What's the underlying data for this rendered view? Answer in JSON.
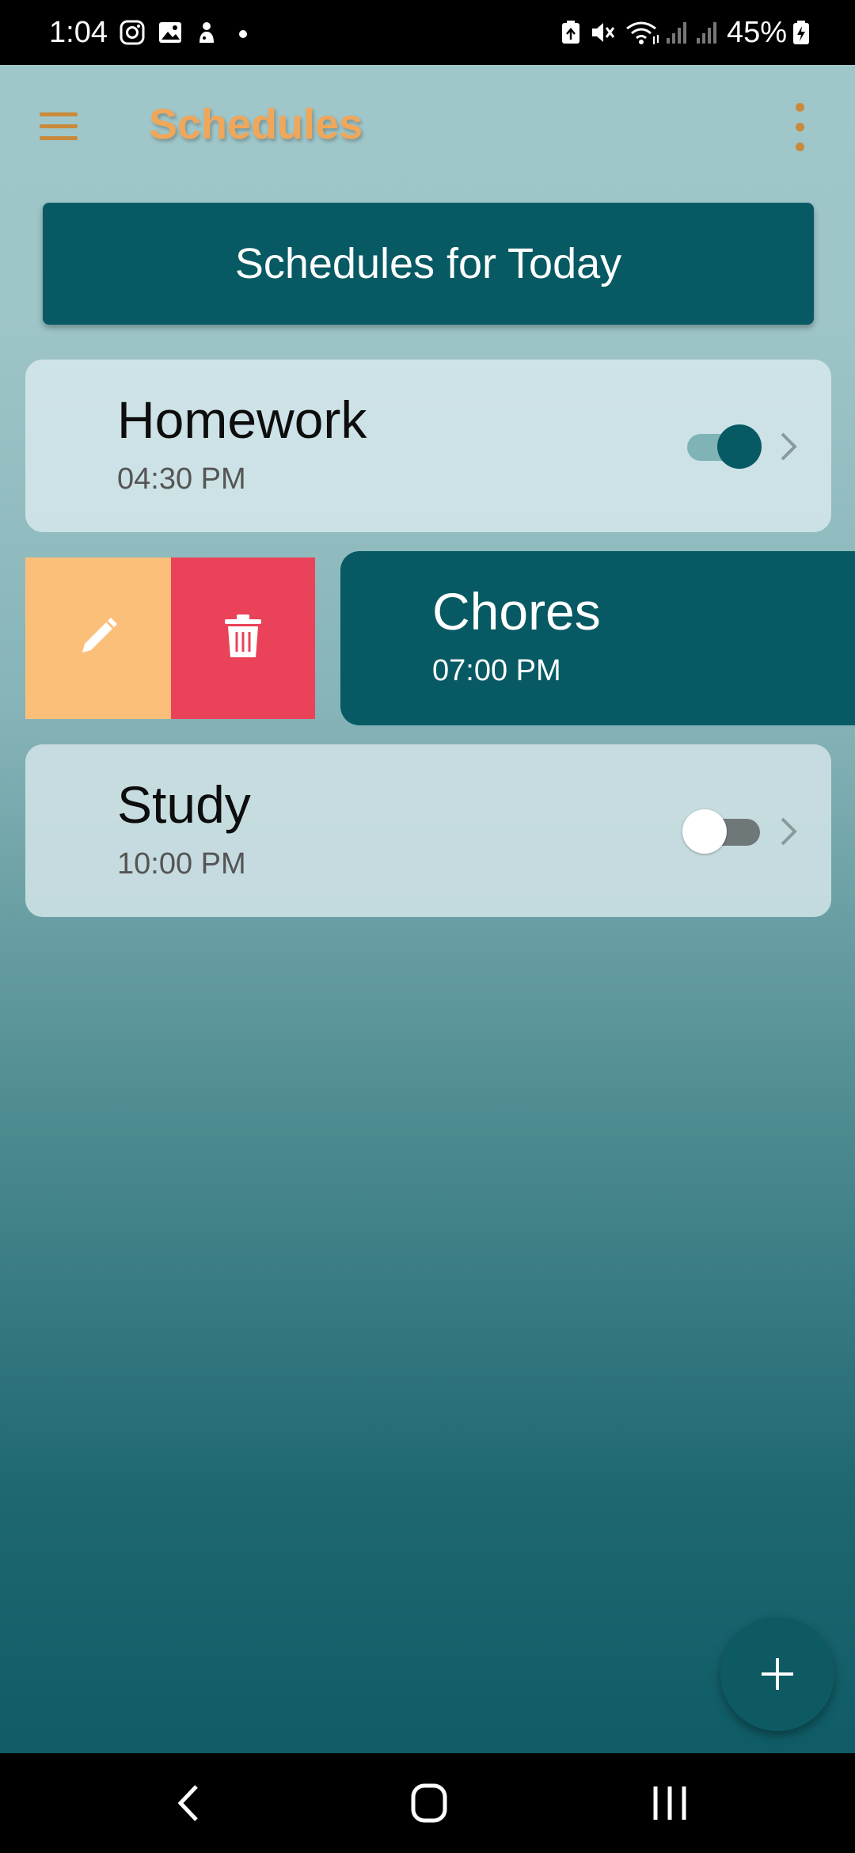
{
  "status_bar": {
    "time": "1:04",
    "battery_percent": "45%",
    "icons": [
      "instagram-icon",
      "gallery-icon",
      "app-notification-icon",
      "battery-saver-icon",
      "mute-icon",
      "wifi-icon",
      "signal-icon",
      "signal-icon",
      "battery-icon"
    ]
  },
  "app_bar": {
    "title": "Schedules",
    "menu_icon": "hamburger-menu-icon",
    "more_icon": "more-vert-icon"
  },
  "banner": {
    "label": "Schedules for Today"
  },
  "schedules": [
    {
      "name": "Homework",
      "time": "04:30 PM",
      "enabled": true
    },
    {
      "name": "Chores",
      "time": "07:00 PM",
      "swiped_open": true
    },
    {
      "name": "Study",
      "time": "10:00 PM",
      "enabled": false
    }
  ],
  "swipe_actions": {
    "edit_icon": "pencil-icon",
    "delete_icon": "trash-icon"
  },
  "fab": {
    "icon": "plus-icon"
  },
  "nav_bar": {
    "icons": [
      "back-icon",
      "home-icon",
      "recents-icon"
    ]
  },
  "colors": {
    "accent_orange": "#f0a75a",
    "teal_dark": "#075a63",
    "edit_orange": "#fbbf7a",
    "delete_red": "#ea4359"
  }
}
